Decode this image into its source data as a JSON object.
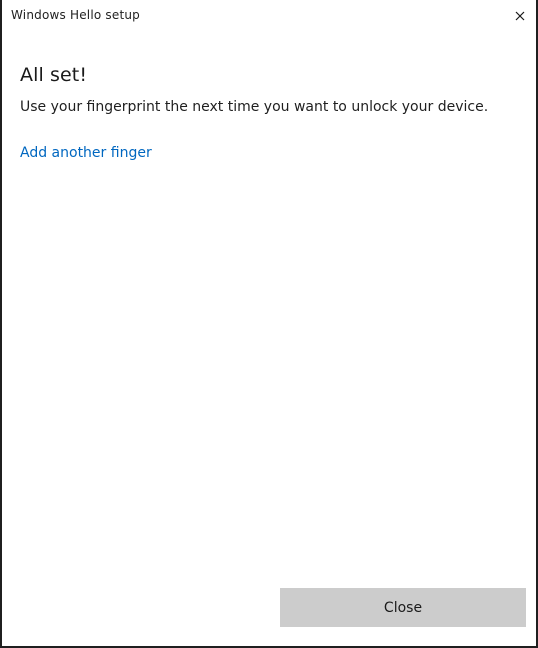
{
  "window": {
    "title": "Windows Hello setup"
  },
  "main": {
    "heading": "All set!",
    "description": "Use your fingerprint the next time you want to unlock your device.",
    "add_finger_link": "Add another finger"
  },
  "footer": {
    "close_label": "Close"
  },
  "icons": {
    "close": "close-icon"
  },
  "colors": {
    "link": "#0067c0",
    "button_bg": "#cccccc",
    "border": "#1f1f1f"
  }
}
